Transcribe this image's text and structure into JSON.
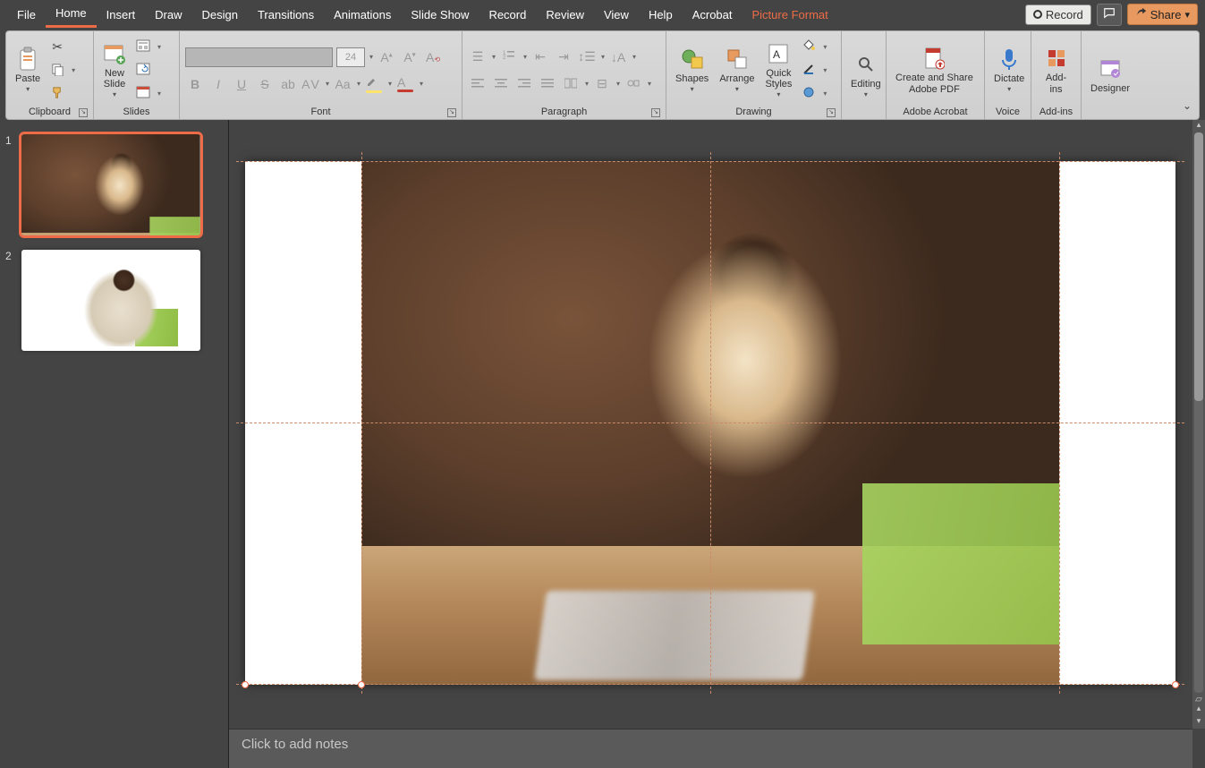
{
  "menu": {
    "tabs": [
      "File",
      "Home",
      "Insert",
      "Draw",
      "Design",
      "Transitions",
      "Animations",
      "Slide Show",
      "Record",
      "Review",
      "View",
      "Help",
      "Acrobat"
    ],
    "contextual_tab": "Picture Format",
    "active_tab": "Home",
    "record_label": "Record",
    "share_label": "Share"
  },
  "ribbon": {
    "clipboard": {
      "paste": "Paste",
      "label": "Clipboard"
    },
    "slides": {
      "new_slide": "New\nSlide",
      "label": "Slides"
    },
    "font": {
      "size_value": "24",
      "label": "Font"
    },
    "paragraph": {
      "label": "Paragraph"
    },
    "drawing": {
      "shapes": "Shapes",
      "arrange": "Arrange",
      "quick_styles": "Quick\nStyles",
      "label": "Drawing"
    },
    "editing": {
      "editing": "Editing"
    },
    "acrobat": {
      "create_share": "Create and Share\nAdobe PDF",
      "label": "Adobe Acrobat"
    },
    "voice": {
      "dictate": "Dictate",
      "label": "Voice"
    },
    "addins": {
      "addins": "Add-ins",
      "label": "Add-ins"
    },
    "designer": {
      "designer": "Designer"
    }
  },
  "thumbnails": {
    "slides": [
      {
        "number": "1",
        "selected": true
      },
      {
        "number": "2",
        "selected": false
      }
    ]
  },
  "notes": {
    "placeholder": "Click to add notes"
  }
}
